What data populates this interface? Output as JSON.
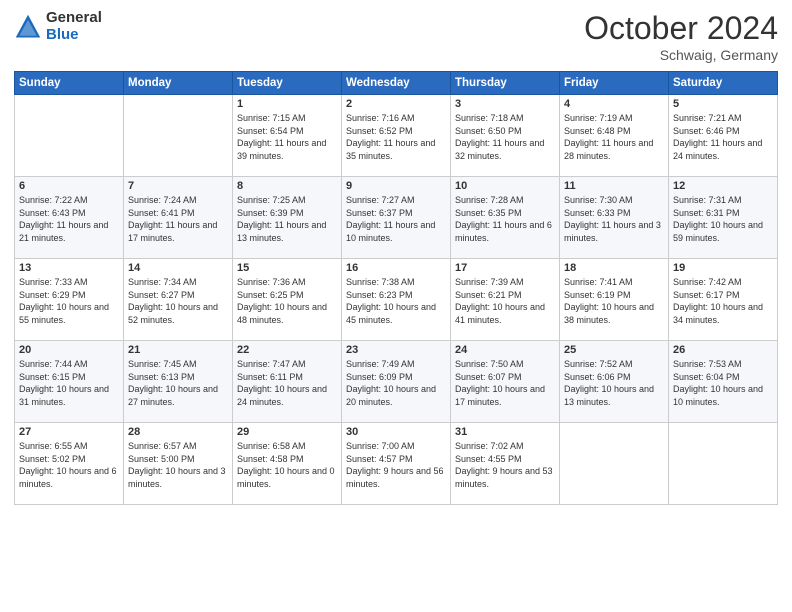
{
  "logo": {
    "general": "General",
    "blue": "Blue"
  },
  "header": {
    "month": "October 2024",
    "location": "Schwaig, Germany"
  },
  "weekdays": [
    "Sunday",
    "Monday",
    "Tuesday",
    "Wednesday",
    "Thursday",
    "Friday",
    "Saturday"
  ],
  "weeks": [
    [
      {
        "day": "",
        "info": ""
      },
      {
        "day": "",
        "info": ""
      },
      {
        "day": "1",
        "info": "Sunrise: 7:15 AM\nSunset: 6:54 PM\nDaylight: 11 hours and 39 minutes."
      },
      {
        "day": "2",
        "info": "Sunrise: 7:16 AM\nSunset: 6:52 PM\nDaylight: 11 hours and 35 minutes."
      },
      {
        "day": "3",
        "info": "Sunrise: 7:18 AM\nSunset: 6:50 PM\nDaylight: 11 hours and 32 minutes."
      },
      {
        "day": "4",
        "info": "Sunrise: 7:19 AM\nSunset: 6:48 PM\nDaylight: 11 hours and 28 minutes."
      },
      {
        "day": "5",
        "info": "Sunrise: 7:21 AM\nSunset: 6:46 PM\nDaylight: 11 hours and 24 minutes."
      }
    ],
    [
      {
        "day": "6",
        "info": "Sunrise: 7:22 AM\nSunset: 6:43 PM\nDaylight: 11 hours and 21 minutes."
      },
      {
        "day": "7",
        "info": "Sunrise: 7:24 AM\nSunset: 6:41 PM\nDaylight: 11 hours and 17 minutes."
      },
      {
        "day": "8",
        "info": "Sunrise: 7:25 AM\nSunset: 6:39 PM\nDaylight: 11 hours and 13 minutes."
      },
      {
        "day": "9",
        "info": "Sunrise: 7:27 AM\nSunset: 6:37 PM\nDaylight: 11 hours and 10 minutes."
      },
      {
        "day": "10",
        "info": "Sunrise: 7:28 AM\nSunset: 6:35 PM\nDaylight: 11 hours and 6 minutes."
      },
      {
        "day": "11",
        "info": "Sunrise: 7:30 AM\nSunset: 6:33 PM\nDaylight: 11 hours and 3 minutes."
      },
      {
        "day": "12",
        "info": "Sunrise: 7:31 AM\nSunset: 6:31 PM\nDaylight: 10 hours and 59 minutes."
      }
    ],
    [
      {
        "day": "13",
        "info": "Sunrise: 7:33 AM\nSunset: 6:29 PM\nDaylight: 10 hours and 55 minutes."
      },
      {
        "day": "14",
        "info": "Sunrise: 7:34 AM\nSunset: 6:27 PM\nDaylight: 10 hours and 52 minutes."
      },
      {
        "day": "15",
        "info": "Sunrise: 7:36 AM\nSunset: 6:25 PM\nDaylight: 10 hours and 48 minutes."
      },
      {
        "day": "16",
        "info": "Sunrise: 7:38 AM\nSunset: 6:23 PM\nDaylight: 10 hours and 45 minutes."
      },
      {
        "day": "17",
        "info": "Sunrise: 7:39 AM\nSunset: 6:21 PM\nDaylight: 10 hours and 41 minutes."
      },
      {
        "day": "18",
        "info": "Sunrise: 7:41 AM\nSunset: 6:19 PM\nDaylight: 10 hours and 38 minutes."
      },
      {
        "day": "19",
        "info": "Sunrise: 7:42 AM\nSunset: 6:17 PM\nDaylight: 10 hours and 34 minutes."
      }
    ],
    [
      {
        "day": "20",
        "info": "Sunrise: 7:44 AM\nSunset: 6:15 PM\nDaylight: 10 hours and 31 minutes."
      },
      {
        "day": "21",
        "info": "Sunrise: 7:45 AM\nSunset: 6:13 PM\nDaylight: 10 hours and 27 minutes."
      },
      {
        "day": "22",
        "info": "Sunrise: 7:47 AM\nSunset: 6:11 PM\nDaylight: 10 hours and 24 minutes."
      },
      {
        "day": "23",
        "info": "Sunrise: 7:49 AM\nSunset: 6:09 PM\nDaylight: 10 hours and 20 minutes."
      },
      {
        "day": "24",
        "info": "Sunrise: 7:50 AM\nSunset: 6:07 PM\nDaylight: 10 hours and 17 minutes."
      },
      {
        "day": "25",
        "info": "Sunrise: 7:52 AM\nSunset: 6:06 PM\nDaylight: 10 hours and 13 minutes."
      },
      {
        "day": "26",
        "info": "Sunrise: 7:53 AM\nSunset: 6:04 PM\nDaylight: 10 hours and 10 minutes."
      }
    ],
    [
      {
        "day": "27",
        "info": "Sunrise: 6:55 AM\nSunset: 5:02 PM\nDaylight: 10 hours and 6 minutes."
      },
      {
        "day": "28",
        "info": "Sunrise: 6:57 AM\nSunset: 5:00 PM\nDaylight: 10 hours and 3 minutes."
      },
      {
        "day": "29",
        "info": "Sunrise: 6:58 AM\nSunset: 4:58 PM\nDaylight: 10 hours and 0 minutes."
      },
      {
        "day": "30",
        "info": "Sunrise: 7:00 AM\nSunset: 4:57 PM\nDaylight: 9 hours and 56 minutes."
      },
      {
        "day": "31",
        "info": "Sunrise: 7:02 AM\nSunset: 4:55 PM\nDaylight: 9 hours and 53 minutes."
      },
      {
        "day": "",
        "info": ""
      },
      {
        "day": "",
        "info": ""
      }
    ]
  ]
}
